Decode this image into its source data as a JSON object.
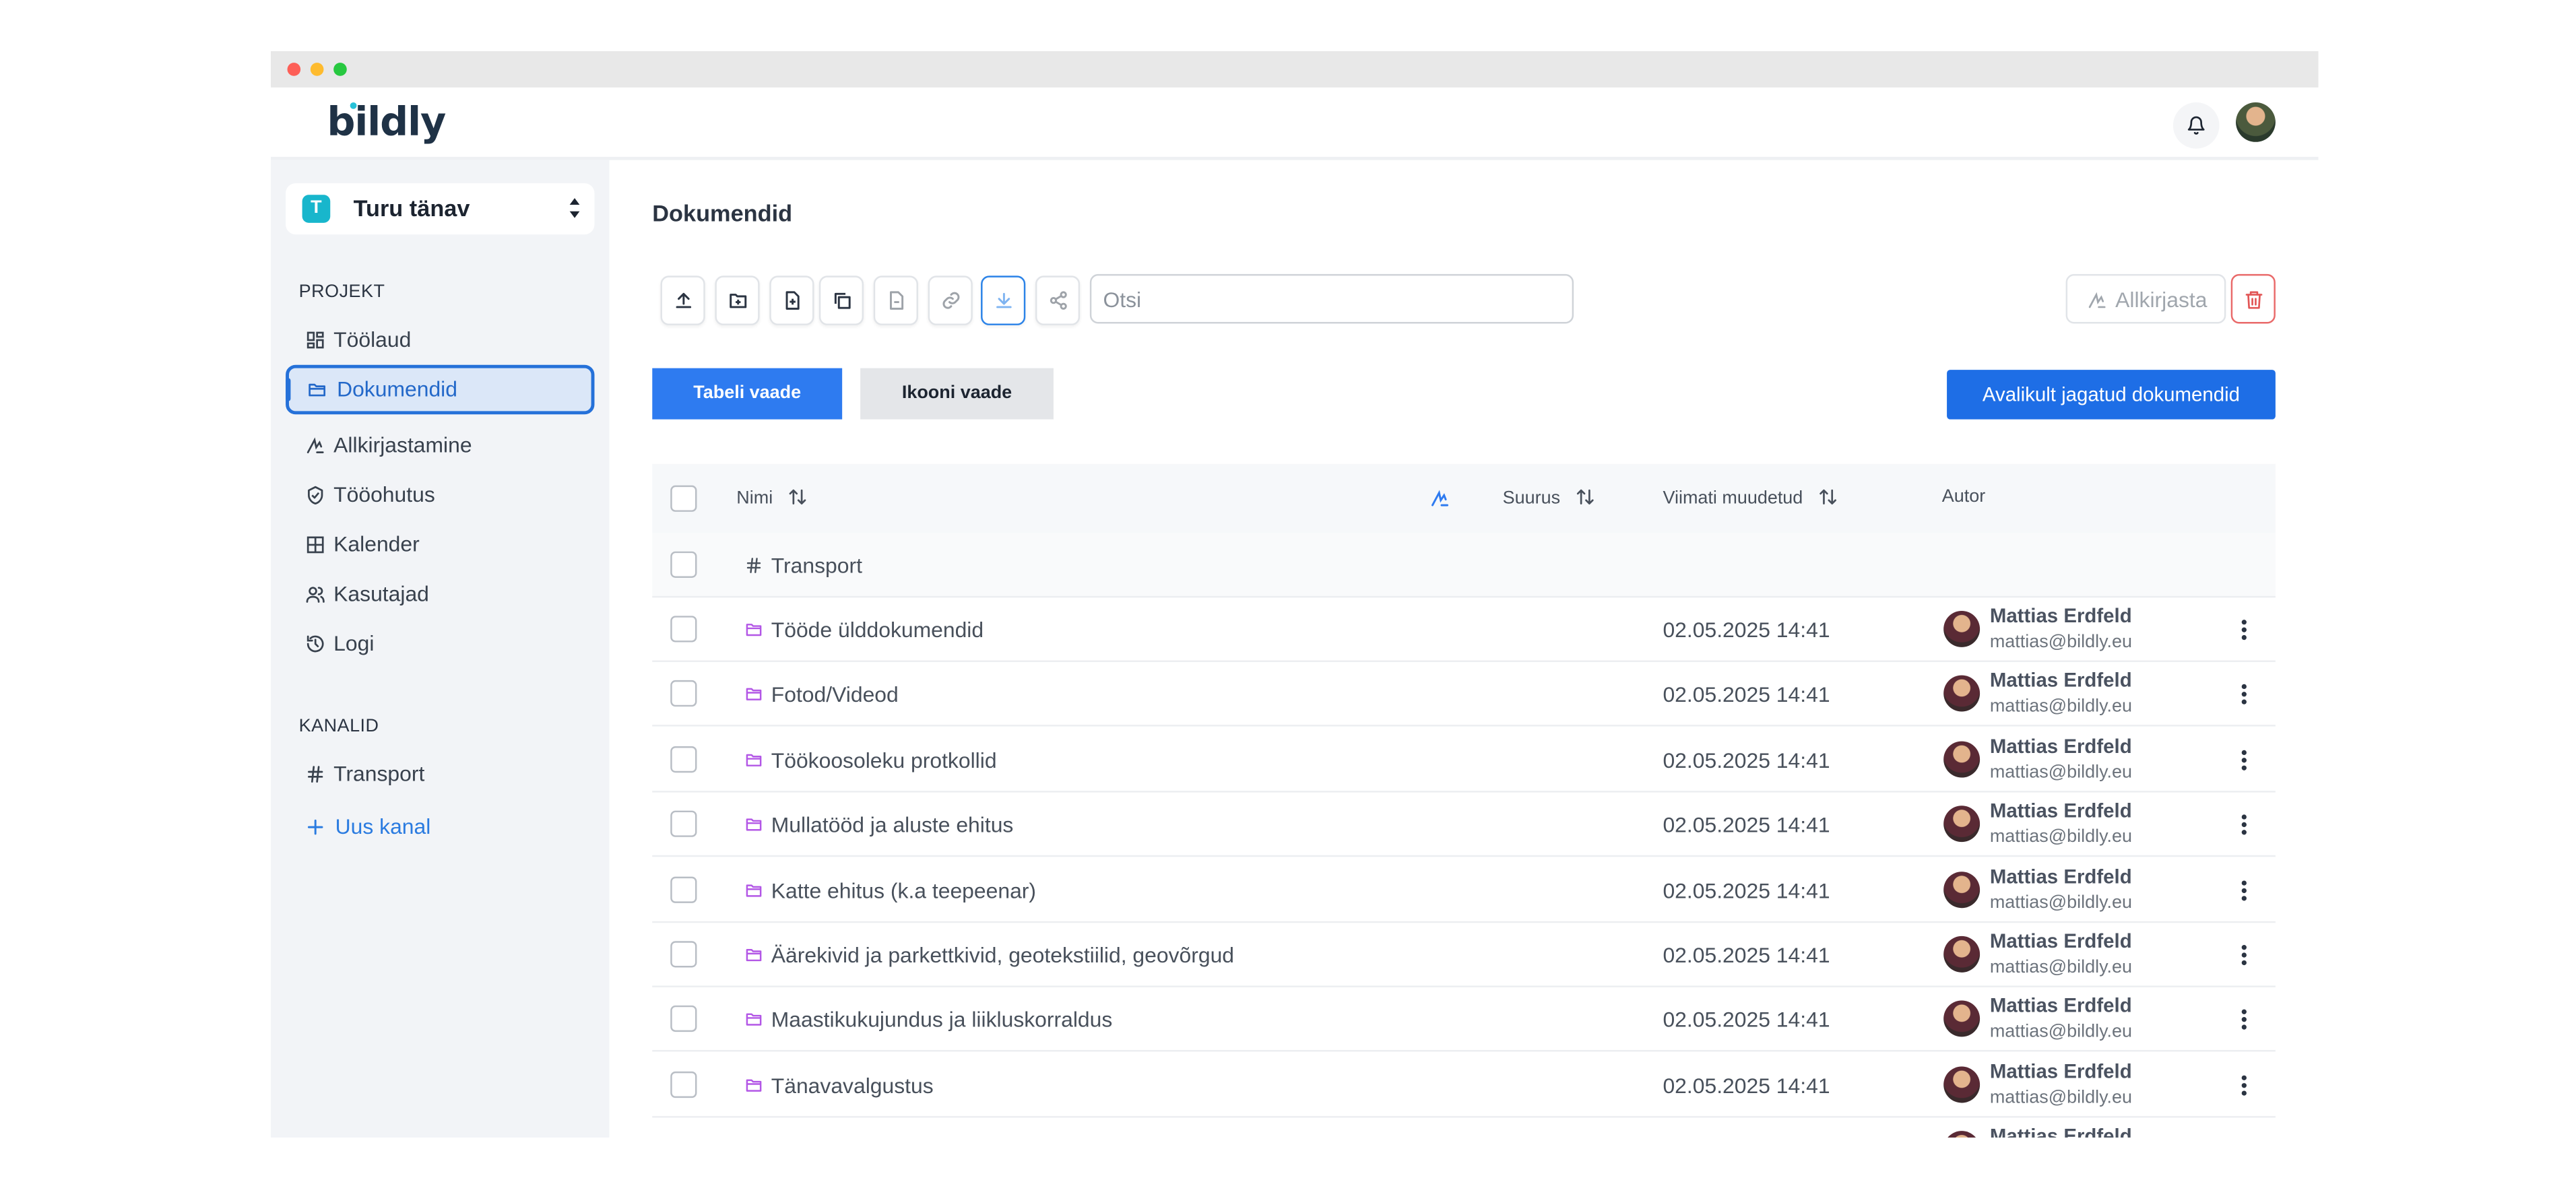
{
  "app": {
    "logo": "bildly",
    "brand_color": "#1f3246",
    "accent_color": "#2e7bf0"
  },
  "header": {
    "notification_icon": "bell-icon",
    "user_avatar": "user-avatar"
  },
  "sidebar": {
    "project": {
      "badge": "T",
      "name": "Turu tänav"
    },
    "project_section_label": "PROJEKT",
    "items": [
      {
        "label": "Töölaud",
        "icon": "dashboard-icon",
        "active": false
      },
      {
        "label": "Dokumendid",
        "icon": "folder-icon",
        "active": true
      },
      {
        "label": "Allkirjastamine",
        "icon": "signature-icon",
        "active": false
      },
      {
        "label": "Tööohutus",
        "icon": "shield-icon",
        "active": false
      },
      {
        "label": "Kalender",
        "icon": "calendar-icon",
        "active": false
      },
      {
        "label": "Kasutajad",
        "icon": "users-icon",
        "active": false
      },
      {
        "label": "Logi",
        "icon": "history-icon",
        "active": false
      }
    ],
    "channels_section_label": "KANALID",
    "channels": [
      {
        "label": "Transport",
        "icon": "hash-icon"
      }
    ],
    "new_channel_label": "Uus kanal"
  },
  "main": {
    "title": "Dokumendid",
    "toolbar": {
      "tools": [
        {
          "name": "upload-file-button",
          "icon": "upload-icon",
          "enabled": true
        },
        {
          "name": "new-folder-button",
          "icon": "folder-plus-icon",
          "enabled": true
        },
        {
          "name": "new-document-button",
          "icon": "file-plus-icon",
          "enabled": true
        },
        {
          "name": "copy-button",
          "icon": "copy-icon",
          "enabled": true
        },
        {
          "name": "file-info-button",
          "icon": "file-icon",
          "enabled": false
        },
        {
          "name": "link-button",
          "icon": "link-icon",
          "enabled": false
        },
        {
          "name": "download-button",
          "icon": "download-icon",
          "enabled": false
        },
        {
          "name": "share-button",
          "icon": "share-icon",
          "enabled": false
        }
      ],
      "search_placeholder": "Otsi",
      "search_value": "",
      "sign_label": "Allkirjasta",
      "delete_icon": "trash-icon"
    },
    "views": {
      "table_view_label": "Tabeli vaade",
      "icon_view_label": "Ikooni vaade",
      "public_docs_label": "Avalikult jagatud dokumendid"
    },
    "table": {
      "columns": {
        "name": "Nimi",
        "size": "Suurus",
        "modified": "Viimati muudetud",
        "author": "Autor"
      },
      "channel_row": {
        "name": "Transport",
        "icon": "hash-icon"
      },
      "rows": [
        {
          "name": "Tööde ülddokumendid",
          "modified": "02.05.2025 14:41",
          "author": "Mattias Erdfeld",
          "email": "mattias@bildly.eu"
        },
        {
          "name": "Fotod/Videod",
          "modified": "02.05.2025 14:41",
          "author": "Mattias Erdfeld",
          "email": "mattias@bildly.eu"
        },
        {
          "name": "Töökoosoleku protkollid",
          "modified": "02.05.2025 14:41",
          "author": "Mattias Erdfeld",
          "email": "mattias@bildly.eu"
        },
        {
          "name": "Mullatööd ja aluste ehitus",
          "modified": "02.05.2025 14:41",
          "author": "Mattias Erdfeld",
          "email": "mattias@bildly.eu"
        },
        {
          "name": "Katte ehitus (k.a teepeenar)",
          "modified": "02.05.2025 14:41",
          "author": "Mattias Erdfeld",
          "email": "mattias@bildly.eu"
        },
        {
          "name": "Äärekivid ja parkettkivid, geotekstiilid, geovõrgud",
          "modified": "02.05.2025 14:41",
          "author": "Mattias Erdfeld",
          "email": "mattias@bildly.eu"
        },
        {
          "name": "Maastikukujundus ja liikluskorraldus",
          "modified": "02.05.2025 14:41",
          "author": "Mattias Erdfeld",
          "email": "mattias@bildly.eu"
        },
        {
          "name": "Tänavavalgustus",
          "modified": "02.05.2025 14:41",
          "author": "Mattias Erdfeld",
          "email": "mattias@bildly.eu"
        },
        {
          "name": "",
          "modified": "",
          "author": "Mattias Erdfeld",
          "email": ""
        }
      ]
    }
  }
}
